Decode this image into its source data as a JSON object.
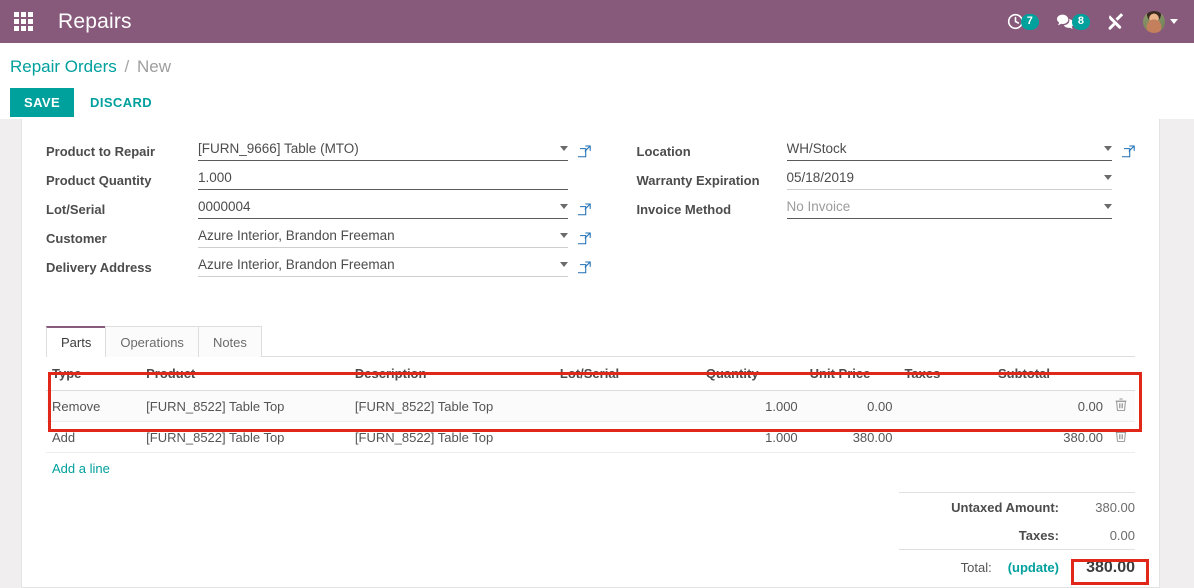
{
  "navbar": {
    "apps_icon": "apps-grid-icon",
    "title": "Repairs",
    "activity_icon": "clock-activity-icon",
    "activity_count": "7",
    "messages_icon": "chat-bubble-icon",
    "messages_count": "8",
    "tools_icon": "crossed-tools-icon",
    "avatar_icon": "user-avatar",
    "brand_color": "#875a7b",
    "accent_color": "#00a09d"
  },
  "control_panel": {
    "breadcrumb_root": "Repair Orders",
    "breadcrumb_separator": "/",
    "breadcrumb_current": "New",
    "save_label": "SAVE",
    "discard_label": "DISCARD"
  },
  "form": {
    "left": [
      {
        "label": "Product to Repair",
        "value": "[FURN_9666] Table (MTO)",
        "has_caret": true,
        "has_external_link": true,
        "muted": false,
        "light_underline": false
      },
      {
        "label": "Product Quantity",
        "value": "1.000",
        "has_caret": false,
        "has_external_link": false,
        "muted": false,
        "light_underline": false
      },
      {
        "label": "Lot/Serial",
        "value": "0000004",
        "has_caret": true,
        "has_external_link": true,
        "muted": false,
        "light_underline": false
      },
      {
        "label": "Customer",
        "value": "Azure Interior, Brandon Freeman",
        "has_caret": true,
        "has_external_link": true,
        "muted": false,
        "light_underline": true
      },
      {
        "label": "Delivery Address",
        "value": "Azure Interior, Brandon Freeman",
        "has_caret": true,
        "has_external_link": true,
        "muted": false,
        "light_underline": true
      }
    ],
    "right": [
      {
        "label": "Location",
        "value": "WH/Stock",
        "has_caret": true,
        "has_external_link": true,
        "muted": false,
        "light_underline": false
      },
      {
        "label": "Warranty Expiration",
        "value": "05/18/2019",
        "has_caret": true,
        "has_external_link": false,
        "muted": false,
        "light_underline": true
      },
      {
        "label": "Invoice Method",
        "value": "No Invoice",
        "has_caret": true,
        "has_external_link": false,
        "muted": true,
        "light_underline": false
      }
    ]
  },
  "tabs": [
    {
      "label": "Parts",
      "active": true
    },
    {
      "label": "Operations",
      "active": false
    },
    {
      "label": "Notes",
      "active": false
    }
  ],
  "lines_table": {
    "headers": [
      "Type",
      "Product",
      "Description",
      "Lot/Serial",
      "Quantity",
      "Unit Price",
      "Taxes",
      "Subtotal"
    ],
    "rows": [
      {
        "type": "Remove",
        "product": "[FURN_8522] Table Top",
        "description": "[FURN_8522] Table Top",
        "lot_serial": "",
        "quantity": "1.000",
        "unit_price": "0.00",
        "taxes": "",
        "subtotal": "0.00",
        "delete_icon": "trash-icon"
      },
      {
        "type": "Add",
        "product": "[FURN_8522] Table Top",
        "description": "[FURN_8522] Table Top",
        "lot_serial": "",
        "quantity": "1.000",
        "unit_price": "380.00",
        "taxes": "",
        "subtotal": "380.00",
        "delete_icon": "trash-icon"
      }
    ],
    "add_line_label": "Add a line"
  },
  "totals": {
    "untaxed_label": "Untaxed Amount:",
    "untaxed_value": "380.00",
    "taxes_label": "Taxes:",
    "taxes_value": "0.00",
    "total_label": "Total:",
    "update_label": "(update)",
    "total_value": "380.00"
  },
  "annotations": {
    "highlight_color": "#e02718",
    "boxes": [
      "parts-lines-highlight",
      "total-amount-highlight"
    ]
  }
}
